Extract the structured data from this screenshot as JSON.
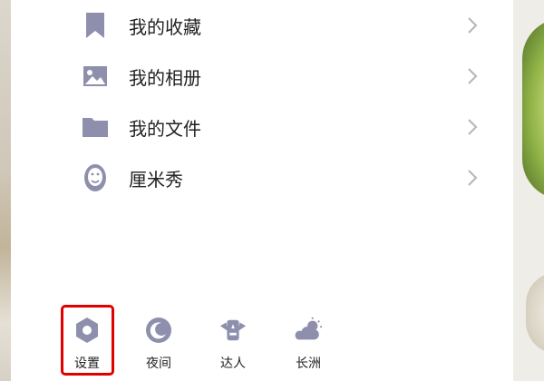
{
  "menu": {
    "items": [
      {
        "label": "我的收藏",
        "icon": "bookmark-icon"
      },
      {
        "label": "我的相册",
        "icon": "photo-album-icon"
      },
      {
        "label": "我的文件",
        "icon": "folder-icon"
      },
      {
        "label": "厘米秀",
        "icon": "cmshow-avatar-icon"
      }
    ]
  },
  "bottom_bar": {
    "settings_label": "设置",
    "night_label": "夜间",
    "expert_label": "达人",
    "weather_label": "长洲"
  },
  "colors": {
    "icon": "#8e8fad",
    "highlight": "#e00000",
    "chevron": "#b5b5b5"
  }
}
